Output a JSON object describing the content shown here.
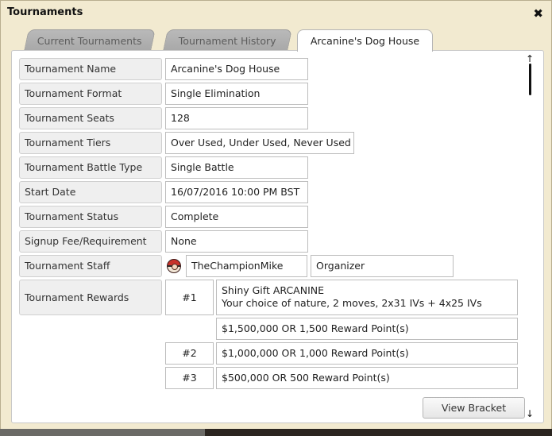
{
  "window": {
    "title": "Tournaments",
    "close_glyph": "✖"
  },
  "tabs": [
    {
      "label": "Current Tournaments",
      "active": false
    },
    {
      "label": "Tournament History",
      "active": false
    },
    {
      "label": "Arcanine's Dog House",
      "active": true
    }
  ],
  "details": {
    "name": {
      "label": "Tournament Name",
      "value": "Arcanine's Dog House"
    },
    "format": {
      "label": "Tournament Format",
      "value": "Single Elimination"
    },
    "seats": {
      "label": "Tournament Seats",
      "value": "128"
    },
    "tiers": {
      "label": "Tournament Tiers",
      "value": "Over Used, Under Used, Never Used"
    },
    "battle": {
      "label": "Tournament Battle Type",
      "value": "Single Battle"
    },
    "start": {
      "label": "Start Date",
      "value": "16/07/2016 10:00 PM BST"
    },
    "status": {
      "label": "Tournament Status",
      "value": "Complete"
    },
    "signup": {
      "label": "Signup Fee/Requirement",
      "value": "None"
    }
  },
  "staff": {
    "label": "Tournament Staff",
    "name": "TheChampionMike",
    "role": "Organizer",
    "avatar_icon": "trainer-avatar-icon"
  },
  "rewards": {
    "label": "Tournament Rewards",
    "entries": [
      {
        "place": "#1",
        "lines": [
          "Shiny Gift ARCANINE",
          "Your choice of nature, 2 moves, 2x31 IVs + 4x25 IVs",
          "$1,500,000 OR 1,500 Reward Point(s)"
        ]
      },
      {
        "place": "#2",
        "lines": [
          "$1,000,000 OR 1,000 Reward Point(s)"
        ]
      },
      {
        "place": "#3",
        "lines": [
          "$500,000 OR 500 Reward Point(s)"
        ]
      }
    ]
  },
  "scroll": {
    "up_glyph": "↑",
    "down_glyph": "↓"
  },
  "actions": {
    "view_bracket": "View Bracket"
  },
  "colors": {
    "window_bg": "#f2ead0",
    "tab_inactive": "#b0b0b0",
    "panel_bg": "#ffffff"
  }
}
